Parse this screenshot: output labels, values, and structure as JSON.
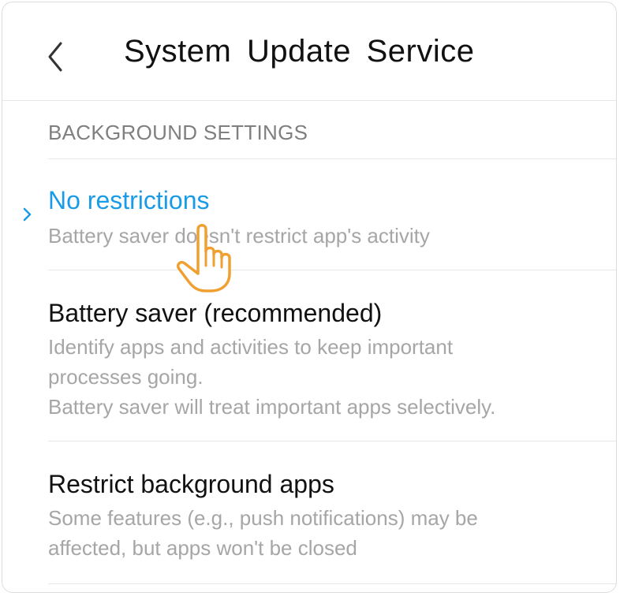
{
  "header": {
    "title": "System  Update  Service",
    "back_icon": "chevron-left-icon"
  },
  "section": {
    "label": "BACKGROUND SETTINGS"
  },
  "options": [
    {
      "title": "No restrictions",
      "description": "Battery saver doesn't restrict app's activity",
      "selected": true
    },
    {
      "title": "Battery saver (recommended)",
      "description_lines": [
        "Identify apps and activities to keep important",
        "processes going.",
        "Battery saver will treat important apps selectively."
      ],
      "selected": false
    },
    {
      "title": "Restrict background apps",
      "description_lines": [
        "Some features (e.g., push notifications) may be",
        "affected, but apps won't be closed"
      ],
      "selected": false
    }
  ],
  "colors": {
    "accent": "#1a9be8",
    "pointer": "#f0a030",
    "title_text": "#111111",
    "secondary_text": "#a6a6a6",
    "section_text": "#7f7f7f"
  },
  "overlay": {
    "pointer_icon": "hand-pointer-icon"
  }
}
